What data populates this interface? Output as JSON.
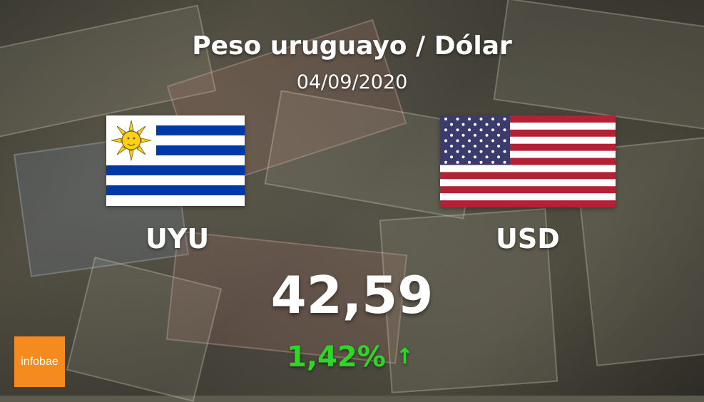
{
  "header": {
    "title": "Peso uruguayo / Dólar",
    "date": "04/09/2020"
  },
  "currencies": {
    "from": {
      "code": "UYU",
      "flag": "uruguay-flag-icon"
    },
    "to": {
      "code": "USD",
      "flag": "usa-flag-icon"
    }
  },
  "rate": {
    "value": "42,59",
    "change": "1,42%",
    "direction_icon": "arrow-up-icon"
  },
  "brand": {
    "logo_text": "infobae",
    "color": "#f58a1f"
  },
  "colors": {
    "positive": "#2fd629",
    "uruguay_blue": "#0038a8",
    "uruguay_sun": "#fcd116",
    "usa_red": "#b22234",
    "usa_blue": "#3c3b6e"
  }
}
